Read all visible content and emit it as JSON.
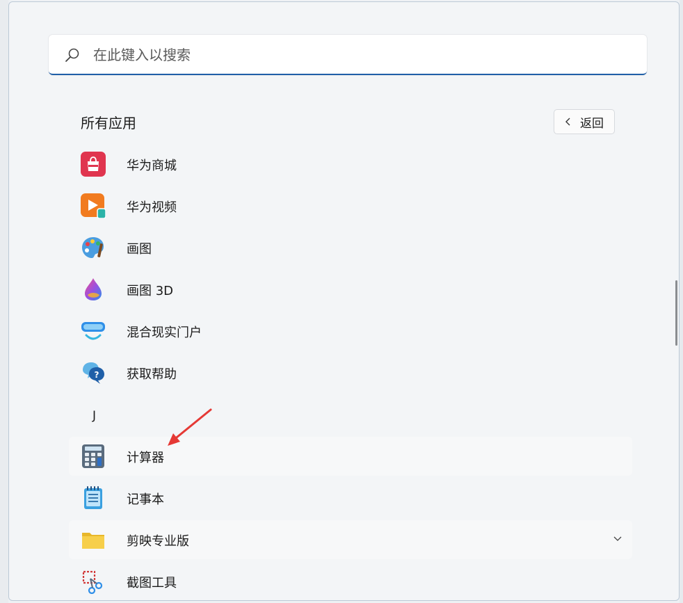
{
  "search": {
    "placeholder": "在此键入以搜索"
  },
  "section": {
    "title": "所有应用",
    "back_label": "返回"
  },
  "apps": [
    {
      "label": "华为商城",
      "icon": "huawei-mall-icon"
    },
    {
      "label": "华为视频",
      "icon": "huawei-video-icon"
    },
    {
      "label": "画图",
      "icon": "paint-icon"
    },
    {
      "label": "画图 3D",
      "icon": "paint-3d-icon"
    },
    {
      "label": "混合现实门户",
      "icon": "mixed-reality-portal-icon"
    },
    {
      "label": "获取帮助",
      "icon": "get-help-icon"
    }
  ],
  "letter_j": "J",
  "apps_j": [
    {
      "label": "计算器",
      "icon": "calculator-icon"
    },
    {
      "label": "记事本",
      "icon": "notepad-icon"
    },
    {
      "label": "剪映专业版",
      "icon": "folder-icon",
      "expandable": true
    },
    {
      "label": "截图工具",
      "icon": "snipping-tool-icon"
    }
  ],
  "colors": {
    "accent": "#1f5fa8",
    "annotation": "#e53935"
  }
}
